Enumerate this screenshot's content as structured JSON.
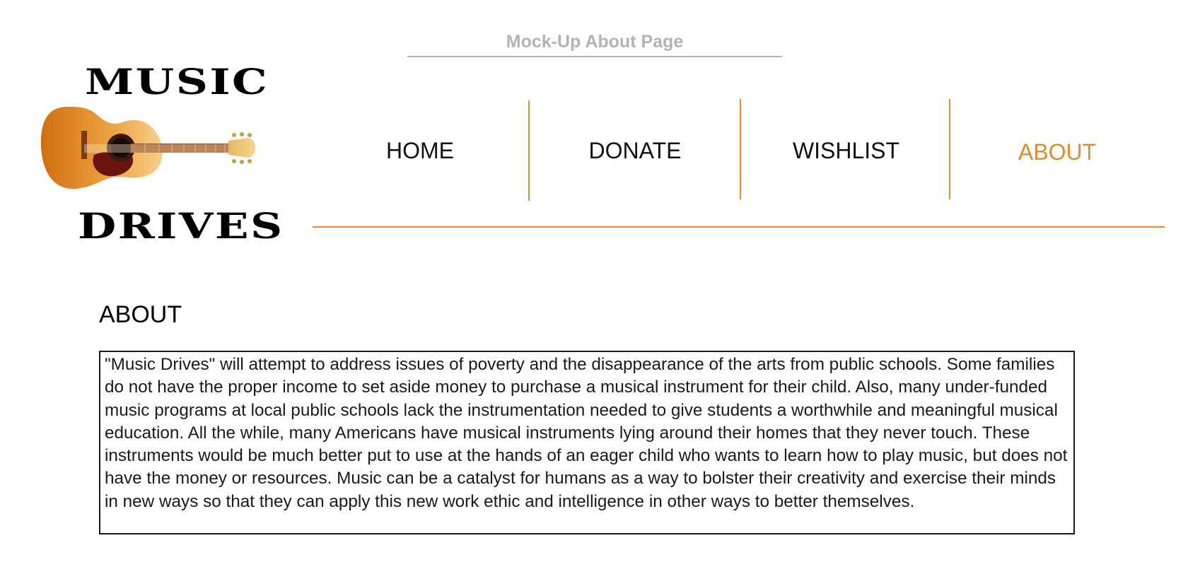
{
  "header": {
    "mockup_title": "Mock-Up About Page"
  },
  "logo": {
    "top_word": "MUSIC",
    "bottom_word": "DRIVES",
    "icon": "acoustic-guitar-icon"
  },
  "nav": {
    "items": [
      {
        "label": "HOME",
        "active": false
      },
      {
        "label": "DONATE",
        "active": false
      },
      {
        "label": "WISHLIST",
        "active": false
      },
      {
        "label": "ABOUT",
        "active": true
      }
    ]
  },
  "main": {
    "heading": "ABOUT",
    "body": "\"Music Drives\" will attempt to address issues of poverty and the disappearance of the arts from public schools. Some families do not have the proper income to set aside money to purchase a musical instrument for their child. Also, many under-funded music programs at local public schools lack the instrumentation needed to give students a worthwhile and meaningful musical education. All the while, many Americans have musical instruments lying around their homes that they never touch. These instruments would be much better put to use at the hands of an eager child who wants to learn how to play music, but does not have the money or resources. Music can be a catalyst for humans as a way to bolster their creativity and exercise their minds in new ways so that they can apply this new work ethic and intelligence in other ways to better themselves."
  },
  "colors": {
    "accent": "#e38b2b",
    "muted_title": "#b3b3b3",
    "text": "#111111"
  }
}
